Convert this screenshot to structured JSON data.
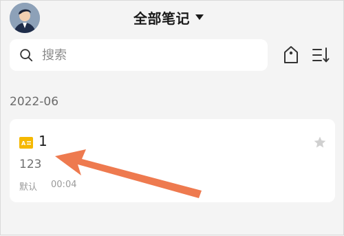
{
  "header": {
    "title": "全部笔记"
  },
  "search": {
    "placeholder": "搜索"
  },
  "section": {
    "date": "2022-06"
  },
  "note": {
    "title": "1",
    "body": "123",
    "category": "默认",
    "time": "00:04"
  },
  "colors": {
    "accent_arrow": "#ee7a4f",
    "note_type_icon": "#f5b800",
    "star": "#d0d0d0"
  },
  "icons": {
    "avatar": "user-avatar",
    "search": "search-icon",
    "tag": "tag-icon",
    "sort": "sort-icon",
    "note_type": "text-note-icon",
    "star": "star-icon"
  }
}
